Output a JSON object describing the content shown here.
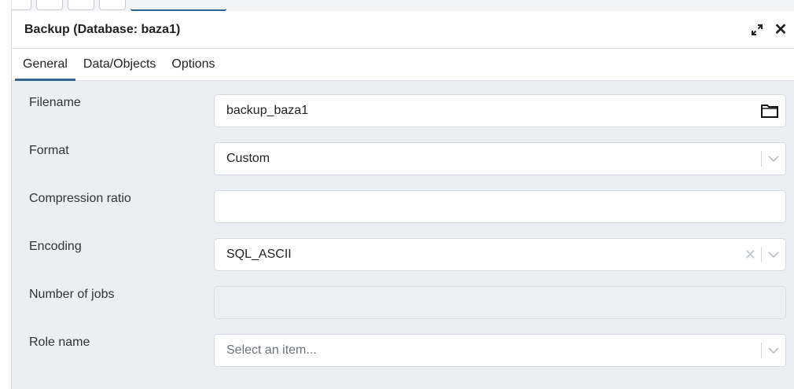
{
  "dialog": {
    "title": "Backup (Database: baza1)",
    "tabs": [
      "General",
      "Data/Objects",
      "Options"
    ],
    "active_tab": "General"
  },
  "fields": {
    "filename": {
      "label": "Filename",
      "value": "backup_baza1"
    },
    "format": {
      "label": "Format",
      "value": "Custom"
    },
    "compression": {
      "label": "Compression ratio",
      "value": ""
    },
    "encoding": {
      "label": "Encoding",
      "value": "SQL_ASCII"
    },
    "jobs": {
      "label": "Number of jobs",
      "value": ""
    },
    "role": {
      "label": "Role name",
      "placeholder": "Select an item..."
    }
  },
  "colors": {
    "accent": "#326690",
    "panel_bg": "#ebeef2"
  },
  "icons": [
    "expand-icon",
    "close-icon",
    "folder-icon",
    "clear-icon",
    "chevron-down-icon"
  ]
}
